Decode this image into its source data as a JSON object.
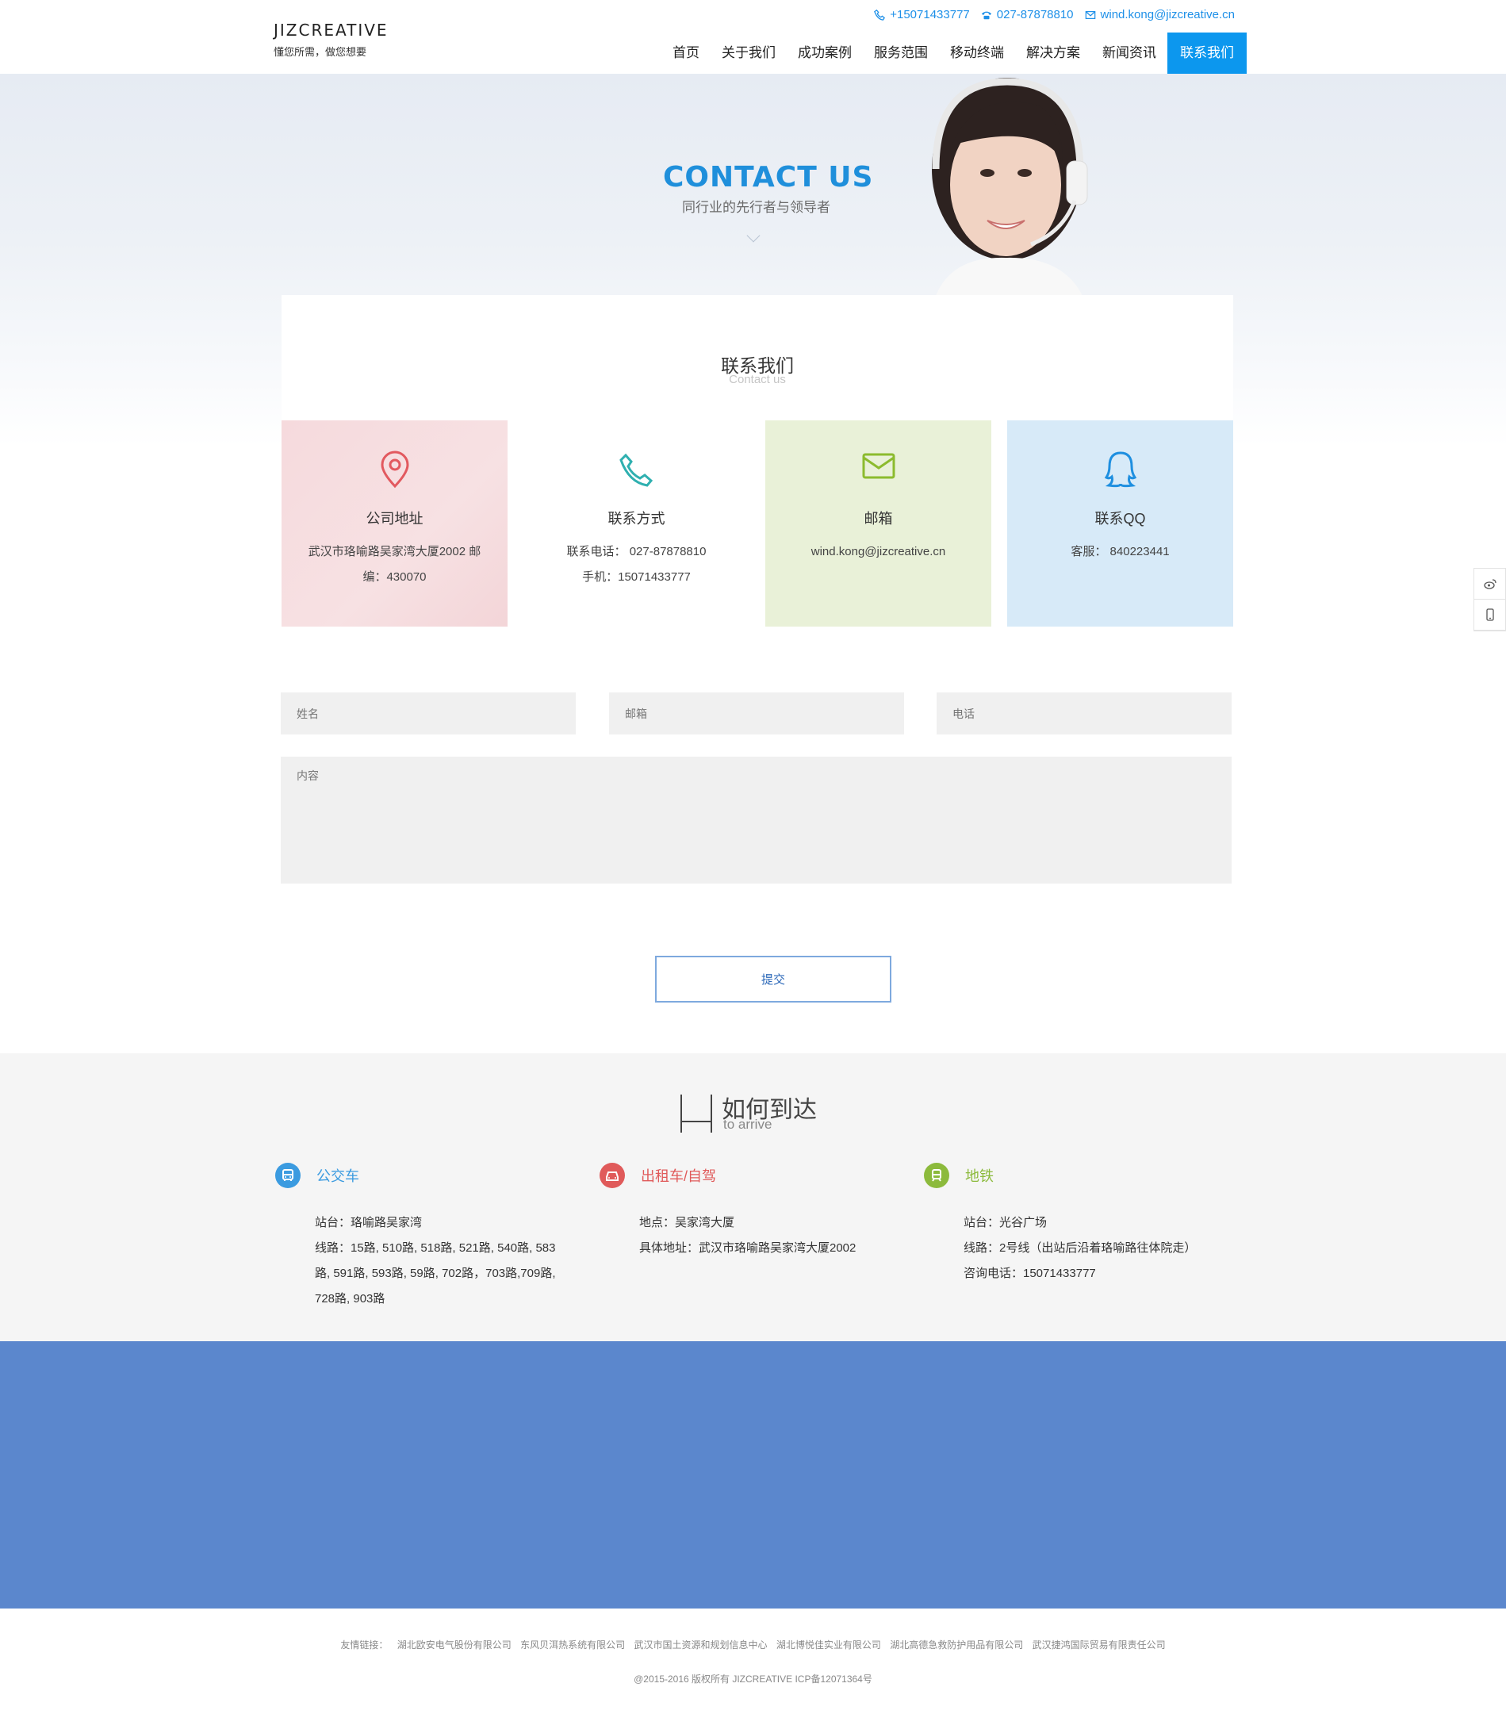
{
  "header": {
    "logo_name": "JIZCREATIVE",
    "logo_slogan": "懂您所需，做您想要",
    "phone_mobile": "+15071433777",
    "phone_tel": "027-87878810",
    "email": "wind.kong@jizcreative.cn",
    "nav": [
      {
        "label": "首页"
      },
      {
        "label": "关于我们"
      },
      {
        "label": "成功案例"
      },
      {
        "label": "服务范围"
      },
      {
        "label": "移动终端"
      },
      {
        "label": "解决方案"
      },
      {
        "label": "新闻资讯"
      },
      {
        "label": "联系我们"
      }
    ],
    "accent": "#0c97ee"
  },
  "hero": {
    "title": "CONTACT US",
    "subtitle": "同行业的先行者与领导者"
  },
  "contact": {
    "title": "联系我们",
    "subtitle": "Contact us",
    "boxes": [
      {
        "title": "公司地址",
        "line1": "武汉市珞喻路吴家湾大厦2002 邮编：430070",
        "line2": "",
        "icon": "location-pin-icon"
      },
      {
        "title": "联系方式",
        "line1": "联系电话： 027-87878810",
        "line2": "手机：15071433777",
        "icon": "phone-icon"
      },
      {
        "title": "邮箱",
        "line1": "wind.kong@jizcreative.cn",
        "line2": "",
        "icon": "mail-icon"
      },
      {
        "title": "联系QQ",
        "line1": "客服： 840223441",
        "line2": "",
        "icon": "qq-icon"
      }
    ]
  },
  "form": {
    "name_placeholder": "姓名",
    "email_placeholder": "邮箱",
    "phone_placeholder": "电话",
    "content_placeholder": "内容",
    "submit_label": "提交"
  },
  "arrive": {
    "title": "如何到达",
    "subtitle": "to arrive",
    "columns": [
      {
        "name": "公交车",
        "color": "#3b9be0",
        "icon": "bus-icon",
        "lines": [
          "站台：珞喻路吴家湾",
          "线路：15路, 510路, 518路, 521路, 540路, 583路, 591路, 593路, 59路, 702路，703路,709路, 728路, 903路"
        ]
      },
      {
        "name": "出租车/自驾",
        "color": "#e05a5a",
        "icon": "car-icon",
        "lines": [
          "地点：吴家湾大厦",
          "具体地址：武汉市珞喻路吴家湾大厦2002"
        ]
      },
      {
        "name": "地铁",
        "color": "#8cba3c",
        "icon": "subway-icon",
        "lines": [
          "站台：光谷广场",
          "线路：2号线（出站后沿着珞喻路往体院走）",
          "咨询电话：15071433777"
        ]
      }
    ]
  },
  "map_band_color": "#5b87cd",
  "footer": {
    "links_label": "友情链接：",
    "links": [
      "湖北欧安电气股份有限公司",
      "东风贝洱热系统有限公司",
      "武汉市国土资源和规划信息中心",
      "湖北博悦佳实业有限公司",
      "湖北高德急救防护用品有限公司",
      "武汉捷鸿国际贸易有限责任公司"
    ],
    "copyright": "@2015-2016 版权所有 JIZCREATIVE ICP备12071364号"
  }
}
